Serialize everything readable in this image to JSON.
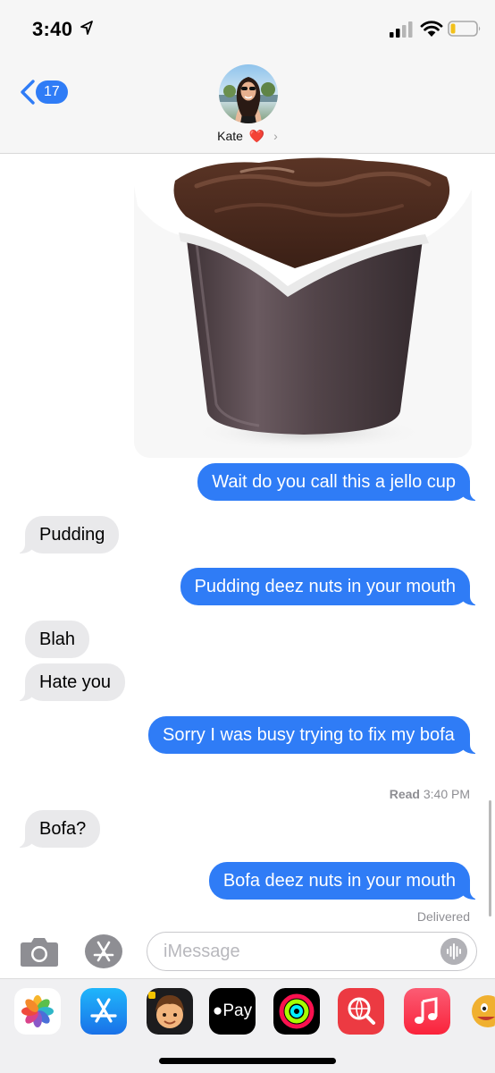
{
  "status_bar": {
    "time": "3:40"
  },
  "header": {
    "back_count": "17",
    "contact_name": "Kate",
    "contact_emoji": "❤️",
    "chevron": "›"
  },
  "messages": [
    {
      "kind": "image",
      "from": "me",
      "subject": "chocolate pudding cup"
    },
    {
      "from": "me",
      "text": "Wait do you call this a jello cup"
    },
    {
      "from": "them",
      "text": "Pudding"
    },
    {
      "from": "me",
      "text": "Pudding deez nuts in your mouth"
    },
    {
      "from": "them",
      "text": "Blah"
    },
    {
      "from": "them",
      "text": "Hate you"
    },
    {
      "from": "me",
      "text": "Sorry I was busy trying to fix my bofa"
    },
    {
      "from": "them",
      "text": "Bofa?"
    },
    {
      "from": "me",
      "text": "Bofa deez nuts in your mouth"
    }
  ],
  "receipts": {
    "read_label": "Read",
    "read_time": "3:40 PM",
    "delivered": "Delivered"
  },
  "input": {
    "placeholder": "iMessage"
  },
  "apps": {
    "apple_pay_label": "Pay",
    "icons": [
      "photos-icon",
      "app-store-icon",
      "memoji-icon",
      "apple-pay-icon",
      "activity-icon",
      "web-search-icon",
      "music-icon",
      "animoji-icon"
    ]
  },
  "colors": {
    "sent_bubble": "#2f7cf6",
    "received_bubble": "#e9e9eb",
    "header_bg": "#f6f6f6"
  }
}
